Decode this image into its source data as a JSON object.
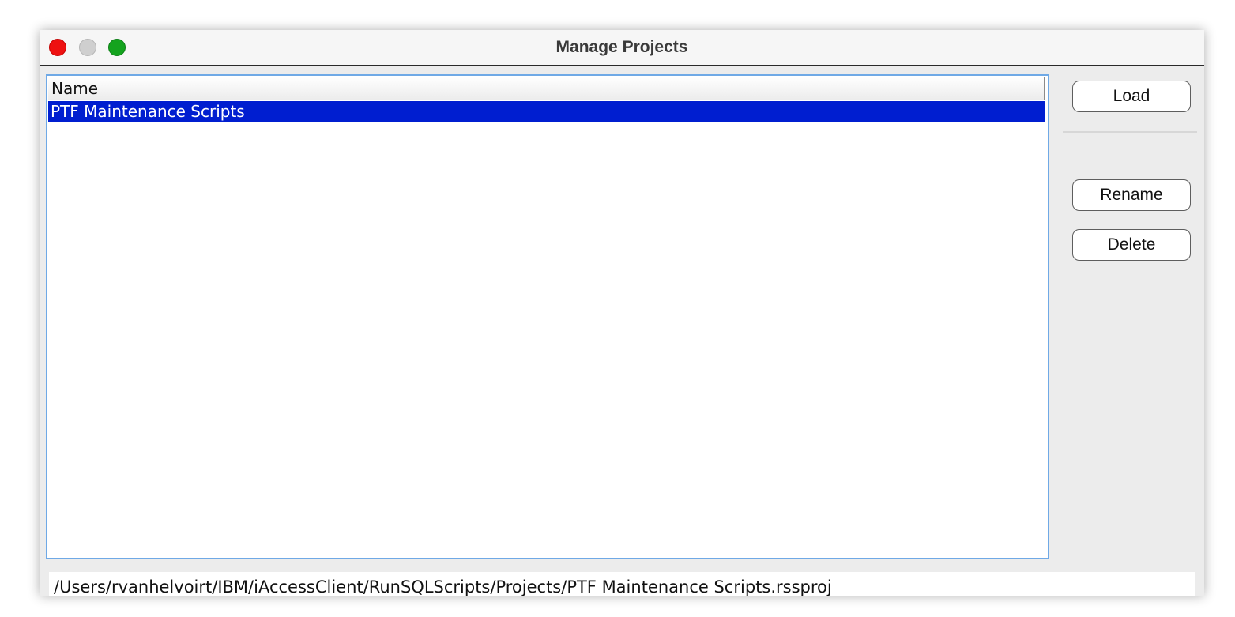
{
  "window": {
    "title": "Manage Projects",
    "controls": {
      "close_color": "#ee1111",
      "minimize_color": "#cfcfcf",
      "zoom_color": "#14a31e"
    }
  },
  "table": {
    "column_header": "Name",
    "rows": [
      {
        "name": "PTF Maintenance Scripts",
        "selected": true
      }
    ],
    "selection_color": "#001ed0",
    "border_color": "#6fa9e6"
  },
  "buttons": {
    "load": "Load",
    "rename": "Rename",
    "delete": "Delete"
  },
  "path": {
    "value": "/Users/rvanhelvoirt/IBM/iAccessClient/RunSQLScripts/Projects/PTF Maintenance Scripts.rssproj"
  }
}
